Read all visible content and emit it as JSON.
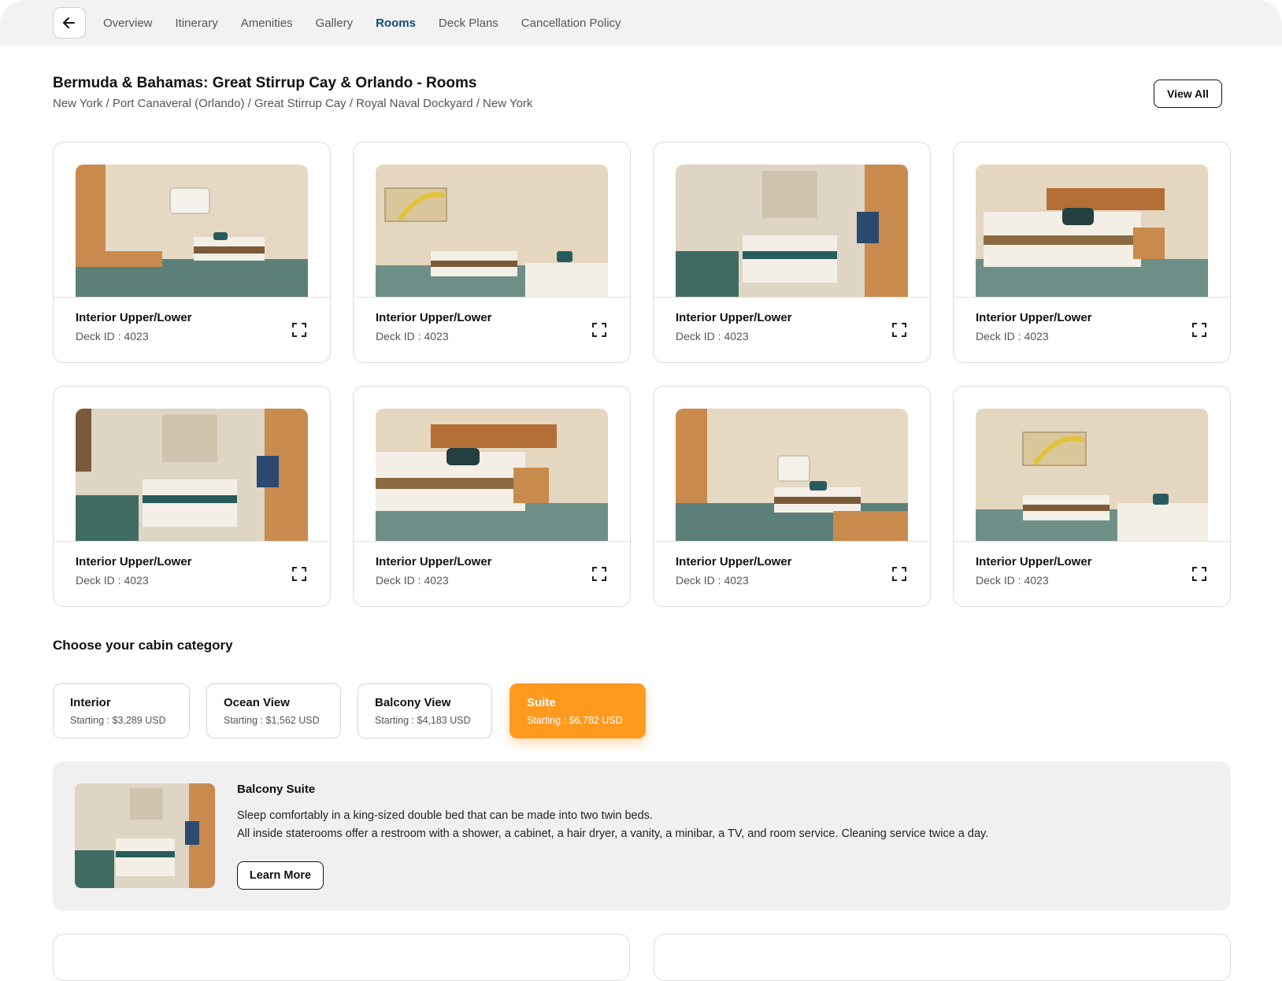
{
  "nav": {
    "items": [
      {
        "label": "Overview"
      },
      {
        "label": "Itinerary"
      },
      {
        "label": "Amenities"
      },
      {
        "label": "Gallery"
      },
      {
        "label": "Rooms",
        "active": true
      },
      {
        "label": "Deck Plans"
      },
      {
        "label": "Cancellation Policy"
      }
    ]
  },
  "header": {
    "title": "Bermuda & Bahamas: Great Stirrup Cay & Orlando - Rooms",
    "route": "New York / Port Canaveral (Orlando) / Great Stirrup Cay / Royal Naval Dockyard / New York",
    "view_all_label": "View All"
  },
  "rooms": [
    {
      "name": "Interior Upper/Lower",
      "deck": "Deck ID : 4023"
    },
    {
      "name": "Interior Upper/Lower",
      "deck": "Deck ID : 4023"
    },
    {
      "name": "Interior Upper/Lower",
      "deck": "Deck ID : 4023"
    },
    {
      "name": "Interior Upper/Lower",
      "deck": "Deck ID : 4023"
    },
    {
      "name": "Interior Upper/Lower",
      "deck": "Deck ID : 4023"
    },
    {
      "name": "Interior Upper/Lower",
      "deck": "Deck ID : 4023"
    },
    {
      "name": "Interior Upper/Lower",
      "deck": "Deck ID : 4023"
    },
    {
      "name": "Interior Upper/Lower",
      "deck": "Deck ID : 4023"
    }
  ],
  "cabin": {
    "section_title": "Choose your cabin category",
    "categories": [
      {
        "name": "Interior",
        "price": "Starting : $3,289 USD"
      },
      {
        "name": "Ocean View",
        "price": "Starting : $1,562 USD"
      },
      {
        "name": "Balcony View",
        "price": "Starting : $4,183 USD"
      },
      {
        "name": "Suite",
        "price": "Starting : $6,782 USD",
        "active": true
      }
    ]
  },
  "detail": {
    "title": "Balcony Suite",
    "line1": "Sleep comfortably in a king-sized double bed that can be made into two twin beds.",
    "line2": "All inside staterooms offer a restroom with a shower, a cabinet, a hair dryer, a vanity, a minibar, a TV, and room service. Cleaning service twice a day.",
    "learn_more_label": "Learn More"
  },
  "colors": {
    "accent": "#ff9a1f",
    "nav_active": "#0f4c75",
    "panel_bg": "#f0f0f0"
  },
  "icons": {
    "back": "arrow-left-icon",
    "expand": "expand-corners-icon"
  }
}
